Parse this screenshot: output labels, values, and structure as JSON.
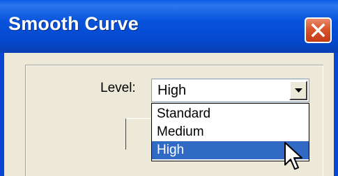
{
  "window": {
    "title": "Smooth Curve"
  },
  "level": {
    "label": "Level:",
    "selected": "High",
    "options": [
      "Standard",
      "Medium",
      "High"
    ],
    "highlighted_index": 2
  },
  "colors": {
    "titlebar": "#0853db",
    "highlight": "#316ac5",
    "close_button": "#d9542c"
  }
}
